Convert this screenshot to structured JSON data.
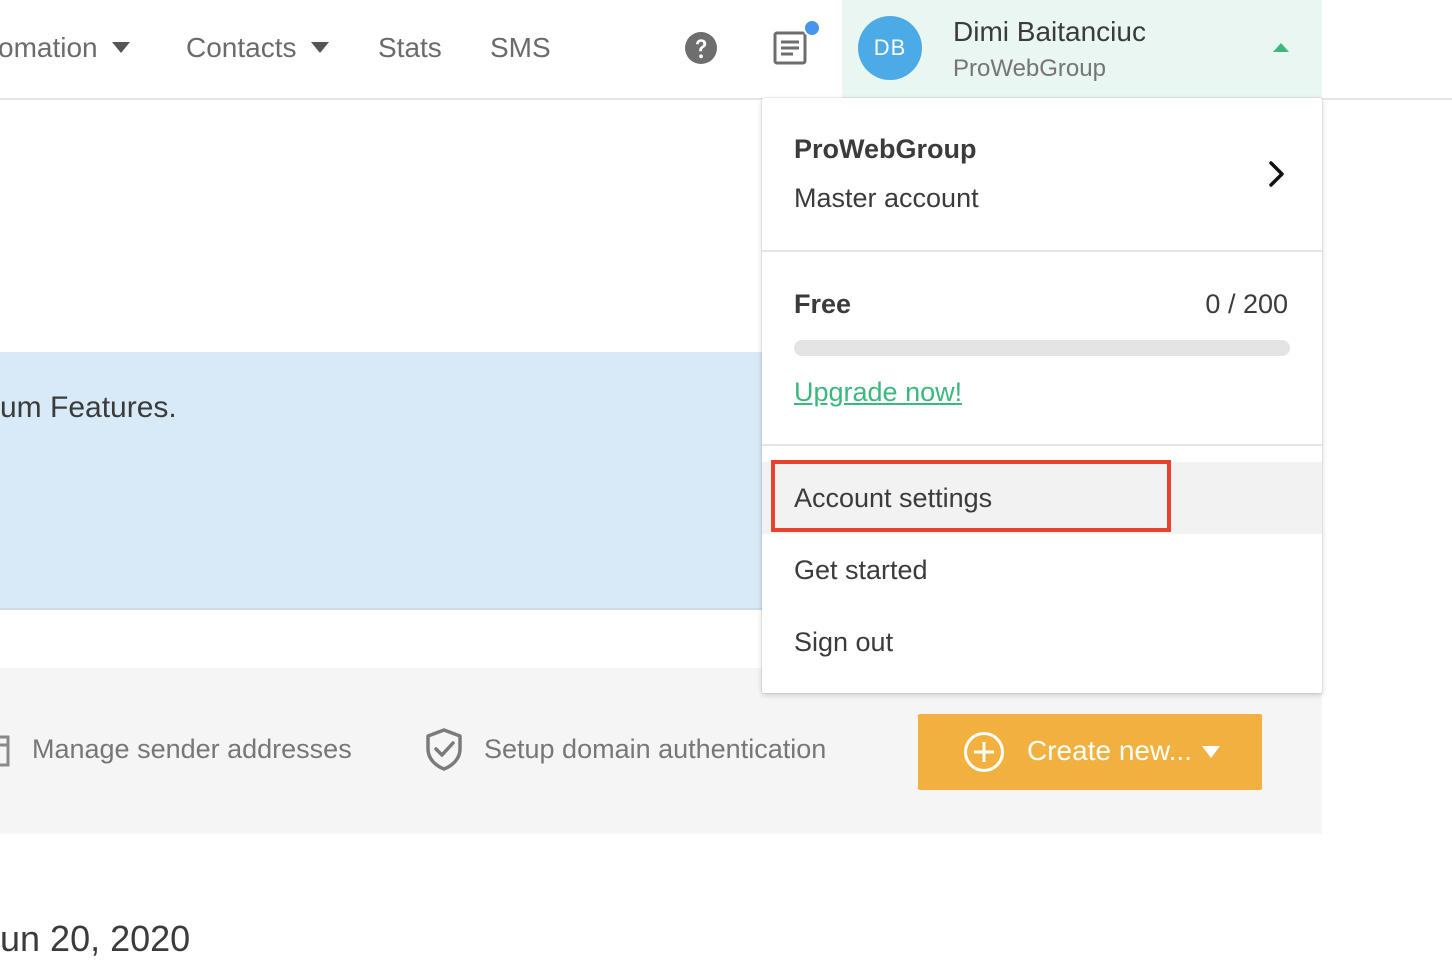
{
  "nav": {
    "items": [
      {
        "label": "omation",
        "has_caret": true
      },
      {
        "label": "Contacts",
        "has_caret": true
      },
      {
        "label": "Stats",
        "has_caret": false
      },
      {
        "label": "SMS",
        "has_caret": false
      }
    ]
  },
  "user": {
    "initials": "DB",
    "name": "Dimi Baitanciuc",
    "org": "ProWebGroup"
  },
  "background": {
    "banner_text": "um Features.",
    "actions": {
      "manage_sender": "Manage sender addresses",
      "domain_auth": "Setup domain authentication",
      "create_new": "Create new..."
    },
    "date_text": "un 20, 2020"
  },
  "dropdown": {
    "org_name": "ProWebGroup",
    "account_type": "Master account",
    "plan": {
      "name": "Free",
      "usage": "0 / 200",
      "progress": 0,
      "upgrade_label": "Upgrade now!"
    },
    "items": {
      "account_settings": "Account settings",
      "get_started": "Get started",
      "sign_out": "Sign out"
    }
  },
  "colors": {
    "accent_green": "#3cb77e",
    "avatar_blue": "#4cabe6",
    "create_orange": "#f2b13e",
    "highlight_red": "#e8412d",
    "banner_blue": "#d8eaf7",
    "notification_blue": "#4696ec"
  },
  "icons": {
    "help": "question-circle-icon",
    "notes": "notes-icon",
    "chevron": "chevron-right-icon",
    "shield": "shield-check-icon",
    "plus": "plus-circle-icon"
  }
}
